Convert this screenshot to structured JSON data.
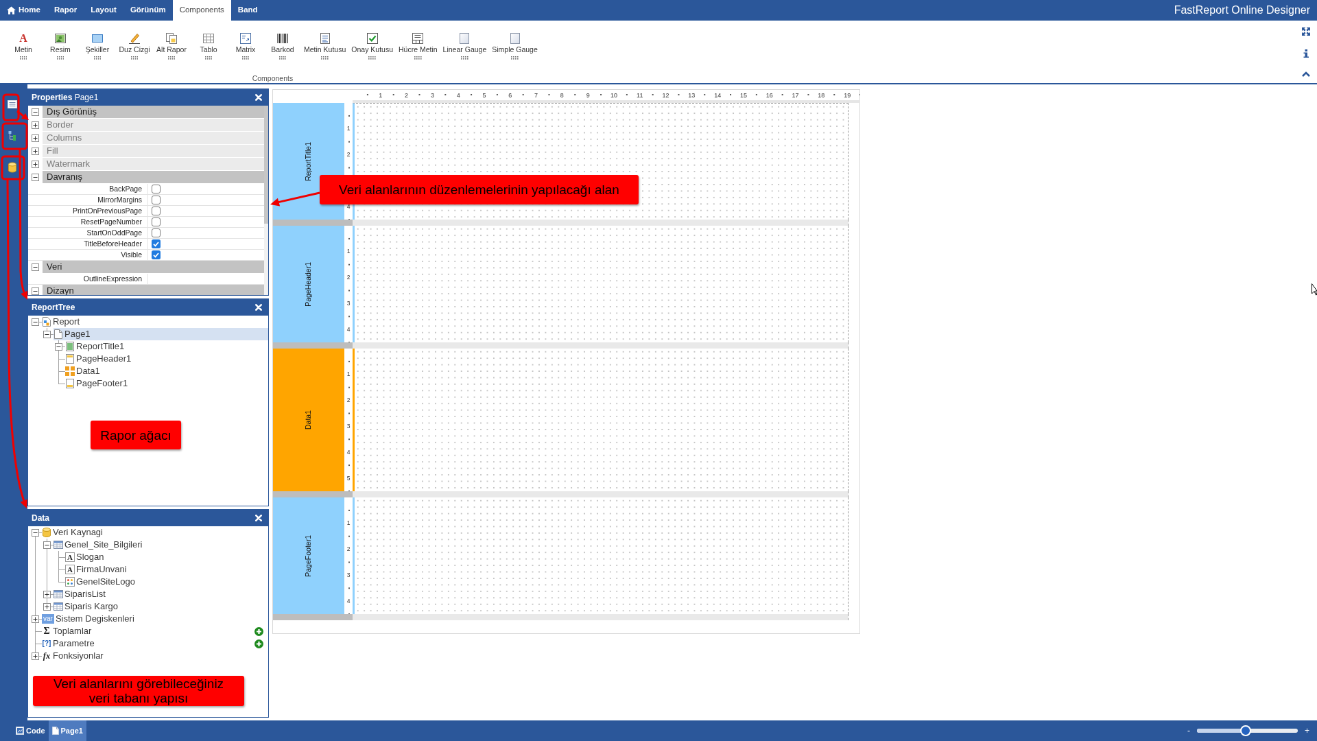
{
  "app": {
    "title": "FastReport Online Designer"
  },
  "menu_tabs": [
    {
      "label": "Home",
      "kind": "home",
      "selected": false
    },
    {
      "label": "Rapor",
      "kind": "plain",
      "selected": false
    },
    {
      "label": "Layout",
      "kind": "plain",
      "selected": false
    },
    {
      "label": "Görünüm",
      "kind": "plain",
      "selected": false
    },
    {
      "label": "Components",
      "kind": "plain",
      "selected": true
    },
    {
      "label": "Band",
      "kind": "plain",
      "selected": false
    }
  ],
  "ribbon": {
    "items": [
      {
        "label": "Metin",
        "kind": "text",
        "glyph": "A"
      },
      {
        "label": "Resim",
        "kind": "picture"
      },
      {
        "label": "Şekiller",
        "kind": "shape"
      },
      {
        "label": "Duz Cizgi",
        "kind": "line"
      },
      {
        "label": "Alt Rapor",
        "kind": "subreport"
      },
      {
        "label": "Tablo",
        "kind": "table"
      },
      {
        "label": "Matrix",
        "kind": "matrix"
      },
      {
        "label": "Barkod",
        "kind": "barcode"
      },
      {
        "label": "Metin Kutusu",
        "kind": "textbox"
      },
      {
        "label": "Onay Kutusu",
        "kind": "checkbox"
      },
      {
        "label": "Hücre Metin",
        "kind": "celltext"
      },
      {
        "label": "Linear Gauge",
        "kind": "gauge"
      },
      {
        "label": "Simple Gauge",
        "kind": "gauge"
      }
    ],
    "group_label": "Components"
  },
  "properties": {
    "title": "**Properties** Page1",
    "rows": [
      {
        "kind": "category",
        "label": "Dış Görünüş",
        "expanded": true
      },
      {
        "kind": "group",
        "label": "Border",
        "expanded": false
      },
      {
        "kind": "group",
        "label": "Columns",
        "expanded": false
      },
      {
        "kind": "group",
        "label": "Fill",
        "expanded": false
      },
      {
        "kind": "group",
        "label": "Watermark",
        "expanded": false
      },
      {
        "kind": "category",
        "label": "Davranış",
        "expanded": true
      },
      {
        "kind": "checkbox",
        "label": "BackPage",
        "checked": false
      },
      {
        "kind": "checkbox",
        "label": "MirrorMargins",
        "checked": false
      },
      {
        "kind": "checkbox",
        "label": "PrintOnPreviousPage",
        "checked": false
      },
      {
        "kind": "checkbox",
        "label": "ResetPageNumber",
        "checked": false
      },
      {
        "kind": "checkbox",
        "label": "StartOnOddPage",
        "checked": false
      },
      {
        "kind": "checkbox",
        "label": "TitleBeforeHeader",
        "checked": true
      },
      {
        "kind": "checkbox",
        "label": "Visible",
        "checked": true
      },
      {
        "kind": "category",
        "label": "Veri",
        "expanded": true
      },
      {
        "kind": "text",
        "label": "OutlineExpression"
      },
      {
        "kind": "category",
        "label": "Dizayn",
        "expanded": true
      }
    ]
  },
  "report_tree": {
    "title": "ReportTree",
    "nodes": [
      {
        "label": "Report",
        "kind": "report",
        "expanded": true,
        "selected": false,
        "children": [
          {
            "label": "Page1",
            "kind": "page",
            "expanded": true,
            "selected": true,
            "children": [
              {
                "label": "ReportTitle1",
                "kind": "report-title",
                "expanded": true,
                "selected": false
              },
              {
                "label": "PageHeader1",
                "kind": "page-header",
                "selected": false
              },
              {
                "label": "Data1",
                "kind": "data-band",
                "selected": false
              },
              {
                "label": "PageFooter1",
                "kind": "page-footer",
                "selected": false
              }
            ]
          }
        ]
      }
    ]
  },
  "data_tree": {
    "title": "Data",
    "nodes": [
      {
        "label": "Veri Kaynagi",
        "kind": "datasource",
        "expanded": true,
        "selected": false,
        "add_button": false,
        "children": [
          {
            "label": "Genel_Site_Bilgileri",
            "kind": "table",
            "expanded": true,
            "selected": false,
            "children": [
              {
                "label": "Slogan",
                "kind": "text-column",
                "glyph": "A",
                "selected": false
              },
              {
                "label": "FirmaUnvani",
                "kind": "text-column",
                "glyph": "A",
                "selected": false
              },
              {
                "label": "GenelSiteLogo",
                "kind": "image-column",
                "selected": false
              }
            ]
          },
          {
            "label": "SiparisList",
            "kind": "table",
            "expanded": false,
            "selected": false
          },
          {
            "label": "Siparis Kargo",
            "kind": "table",
            "expanded": false,
            "selected": false
          }
        ]
      },
      {
        "label": "Sistem Degiskenleri",
        "kind": "variables",
        "glyph": "var",
        "expanded": false,
        "selected": false,
        "add_button": false
      },
      {
        "label": "Toplamlar",
        "kind": "totals",
        "glyph": "Σ",
        "selected": false,
        "add_button": true
      },
      {
        "label": "Parametre",
        "kind": "parameters",
        "glyph": "[?]",
        "selected": false,
        "add_button": true
      },
      {
        "label": "Fonksiyonlar",
        "kind": "functions",
        "glyph": "fx",
        "expanded": false,
        "selected": false,
        "add_button": false
      }
    ]
  },
  "canvas": {
    "ruler": [
      "1",
      "2",
      "3",
      "4",
      "5",
      "6",
      "7",
      "8",
      "9",
      "10",
      "11",
      "12",
      "13",
      "14",
      "15",
      "16",
      "17",
      "18",
      "19"
    ],
    "bands": [
      {
        "name": "ReportTitle1",
        "color": "#8fd1fd",
        "ruler": [
          "1",
          "2",
          "4"
        ]
      },
      {
        "name": "PageHeader1",
        "color": "#8fd1fd",
        "ruler": [
          "1",
          "2",
          "3",
          "4"
        ]
      },
      {
        "name": "Data1",
        "color": "#ffa500",
        "ruler": [
          "1",
          "2",
          "3",
          "4",
          "5"
        ]
      },
      {
        "name": "PageFooter1",
        "color": "#8fd1fd",
        "ruler": [
          "1",
          "2",
          "3",
          "4"
        ]
      }
    ]
  },
  "annotations": [
    {
      "text": "Veri alanlarının düzenlemelerinin yapılacağı alan"
    },
    {
      "text": "Rapor ağacı"
    },
    {
      "text": "Veri alanlarını görebileceğiniz\nveri tabanı yapısı"
    }
  ],
  "status_bar": {
    "tabs": [
      {
        "label": "Code",
        "kind": "code",
        "selected": false
      },
      {
        "label": "Page1",
        "kind": "page",
        "selected": true
      }
    ],
    "zoom_out": "-",
    "zoom_in": "+",
    "zoom": {
      "level": 0.48
    }
  }
}
